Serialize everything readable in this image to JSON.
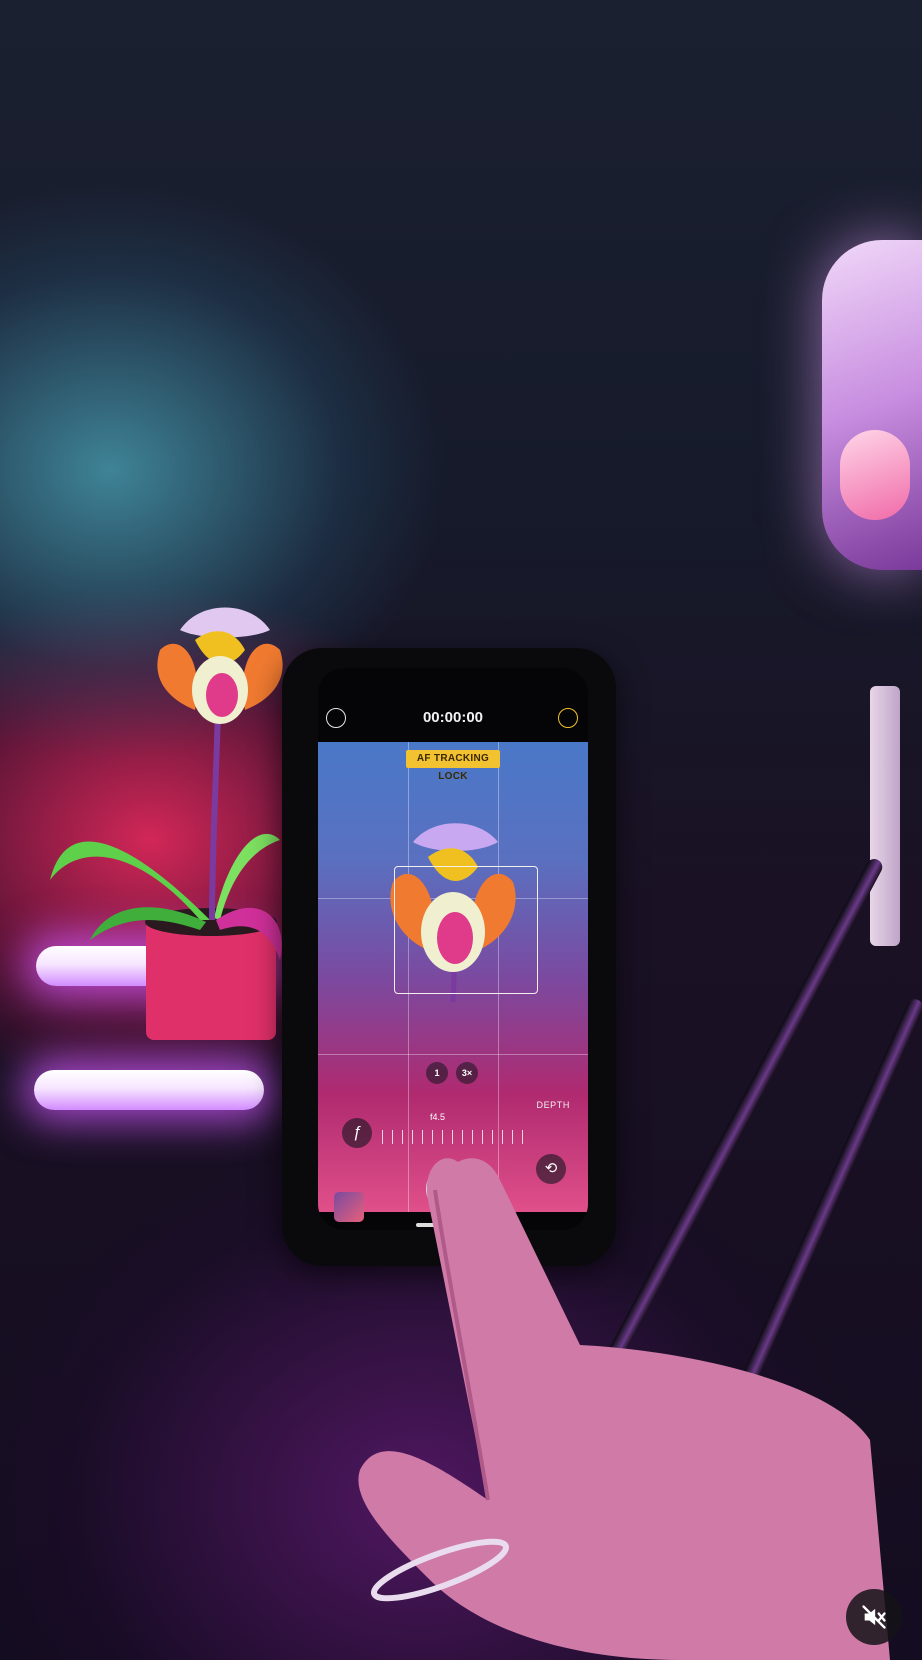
{
  "phone": {
    "timer": "00:00:00",
    "af_badge": "AF TRACKING LOCK",
    "zoom_options": [
      "1",
      "3×"
    ],
    "depth_label": "DEPTH",
    "dial_value": "f4.5"
  },
  "video_controls": {
    "mute_icon": "speaker-muted-icon"
  },
  "colors": {
    "af_badge": "#f2c230",
    "mute_button_bg": "#141418"
  }
}
